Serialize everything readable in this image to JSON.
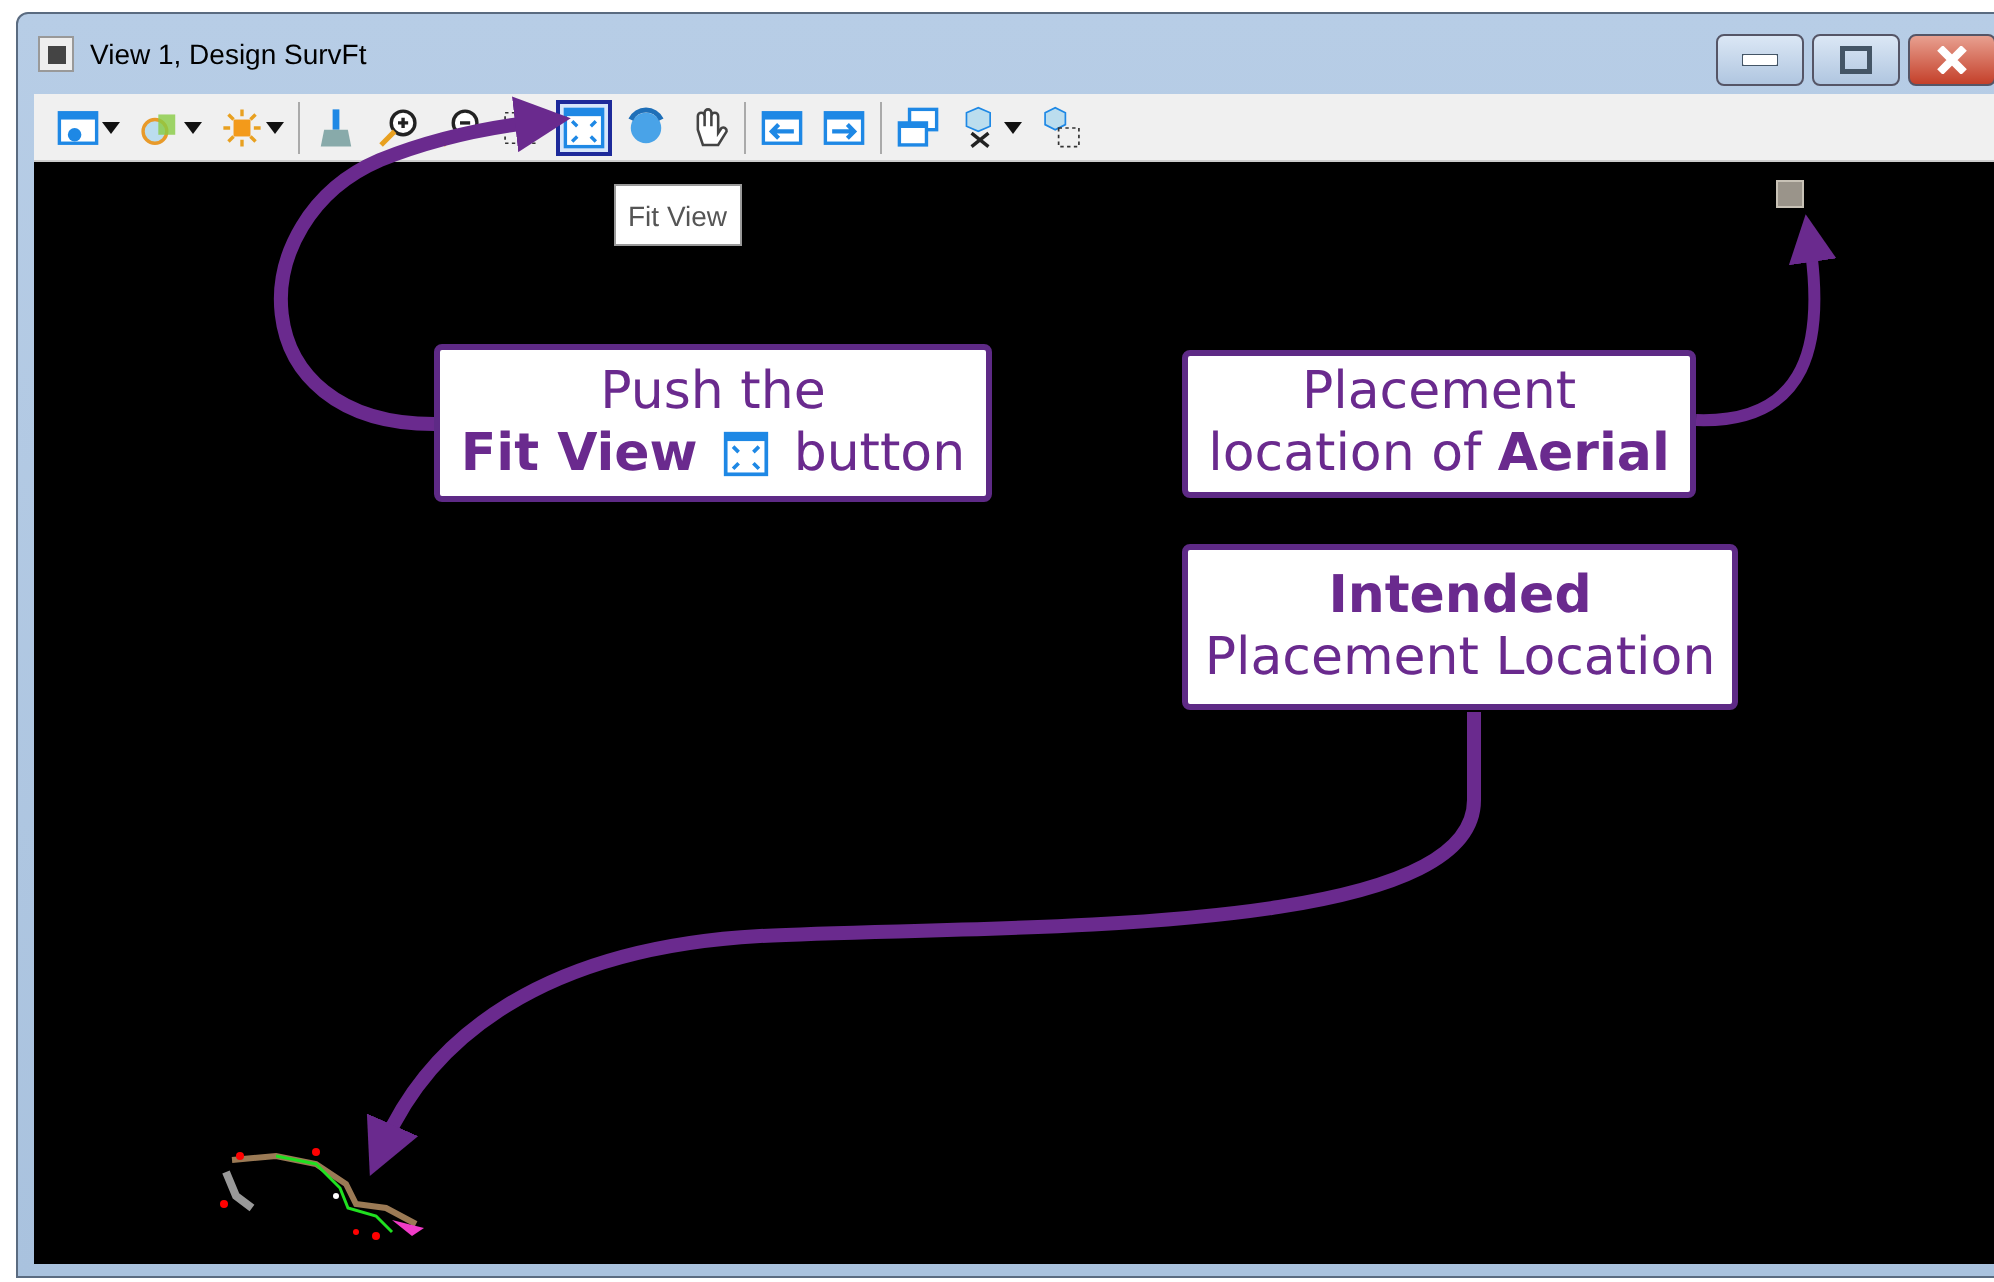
{
  "window": {
    "title": "View 1, Design SurvFt"
  },
  "toolbar": {
    "groups": [
      {
        "buttons": [
          {
            "dropdown": true,
            "selected": false
          },
          {
            "dropdown": true,
            "selected": false
          },
          {
            "dropdown": true,
            "selected": false
          }
        ]
      },
      {
        "buttons": [
          {
            "dropdown": false,
            "selected": false
          },
          {
            "dropdown": false,
            "selected": false
          },
          {
            "dropdown": false,
            "selected": false
          },
          {
            "dropdown": false,
            "selected": false
          },
          {
            "dropdown": false,
            "selected": true
          },
          {
            "dropdown": false,
            "selected": false
          },
          {
            "dropdown": false,
            "selected": false
          }
        ]
      },
      {
        "buttons": [
          {
            "dropdown": false,
            "selected": false
          },
          {
            "dropdown": false,
            "selected": false
          }
        ]
      },
      {
        "buttons": [
          {
            "dropdown": false,
            "selected": false
          },
          {
            "dropdown": true,
            "selected": false
          },
          {
            "dropdown": false,
            "selected": false
          }
        ]
      }
    ]
  },
  "tooltip": {
    "text": "Fit View"
  },
  "callouts": [
    {
      "lines": [
        {
          "text": "Push the"
        },
        {
          "text": "**Fit View**",
          "icon": true,
          "after": "button"
        }
      ]
    },
    {
      "lines": [
        {
          "text": "Placement"
        },
        {
          "text": "location of **Aerial**"
        }
      ]
    },
    {
      "lines": [
        {
          "text": "**Intended**"
        },
        {
          "text": "Placement Location"
        }
      ]
    }
  ]
}
